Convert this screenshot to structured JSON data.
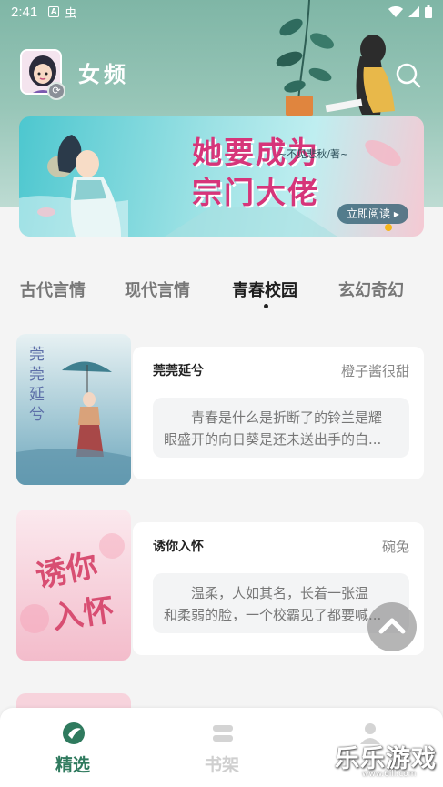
{
  "status_bar": {
    "time": "2:41",
    "left_icons": [
      "a-badge-icon",
      "chinese-glyph-icon"
    ],
    "right_icons": [
      "wifi-icon",
      "signal-icon",
      "battery-icon"
    ],
    "glyph": "虫",
    "badge_letter": "A"
  },
  "header": {
    "channel_title": "女频"
  },
  "banner": {
    "title_line1": "她要成为",
    "title_line2": "宗门大佬",
    "author": "~不见悲秋/著~",
    "read_button": "立即阅读 ▸"
  },
  "tabs": [
    {
      "label": "古代言情",
      "active": false
    },
    {
      "label": "现代言情",
      "active": false
    },
    {
      "label": "青春校园",
      "active": true
    },
    {
      "label": "玄幻奇幻",
      "active": false
    }
  ],
  "books": [
    {
      "title": "莞莞延兮",
      "author": "橙子酱很甜",
      "desc_line1": "青春是什么是折断了的铃兰是耀",
      "desc_line2": "眼盛开的向日葵是还未送出手的白...",
      "cover_text": "莞莞延兮"
    },
    {
      "title": "诱你入怀",
      "author": "碗兔",
      "desc_line1": "温柔，人如其名，长着一张温",
      "desc_line2": "和柔弱的脸，一个校霸见了都要喊...",
      "cover_text": "诱你入怀"
    }
  ],
  "bottom_nav": [
    {
      "label": "精选",
      "active": true
    },
    {
      "label": "书架",
      "active": false
    },
    {
      "label": "",
      "active": false
    }
  ],
  "watermark": {
    "text": "乐乐游戏",
    "url": "www.6ill.com"
  },
  "colors": {
    "accent": "#2f7a5e",
    "header_bg": "#8fc0b2",
    "banner_title": "#d6357a"
  }
}
